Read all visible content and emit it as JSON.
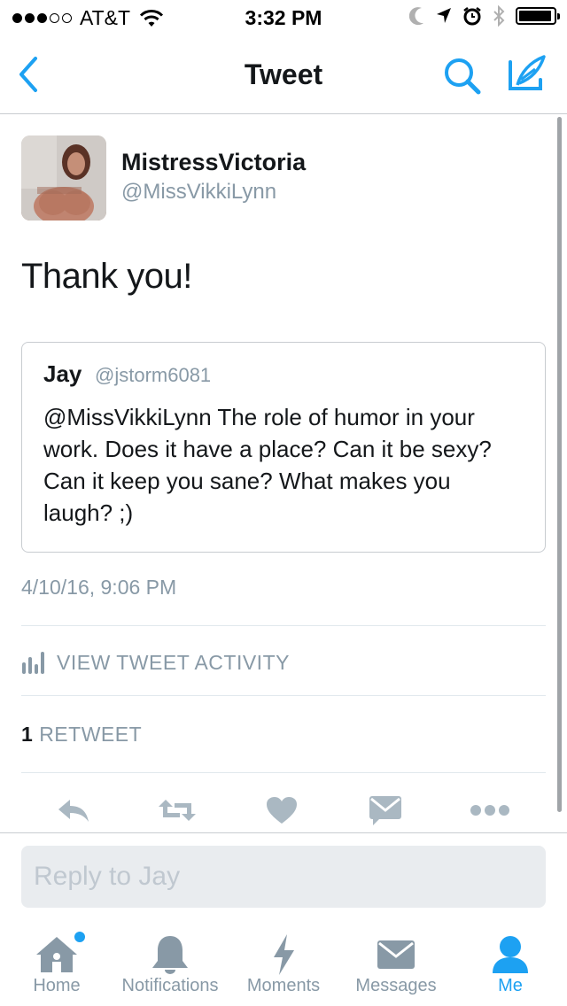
{
  "status_bar": {
    "carrier": "AT&T",
    "time": "3:32 PM",
    "signal_dots_filled": 3,
    "signal_dots_total": 5,
    "icons": [
      "wifi-icon",
      "moon-icon",
      "location-arrow-icon",
      "alarm-icon",
      "bluetooth-icon",
      "battery-icon"
    ]
  },
  "nav": {
    "title": "Tweet",
    "back_icon": "chevron-left-icon",
    "search_icon": "search-icon",
    "compose_icon": "compose-feather-icon"
  },
  "tweet": {
    "display_name": "MistressVictoria",
    "screen_name": "@MissVikkiLynn",
    "text": "Thank you!",
    "timestamp": "4/10/16, 9:06 PM",
    "activity_label": "VIEW TWEET ACTIVITY",
    "retweet_count": "1",
    "retweet_label": "RETWEET"
  },
  "quoted": {
    "name": "Jay",
    "handle": "@jstorm6081",
    "text": "@MissVikkiLynn The role of humor in your work. Does it have a place? Can it be sexy? Can it keep you sane? What makes you laugh? ;)"
  },
  "actions": [
    "reply-icon",
    "retweet-icon",
    "heart-icon",
    "direct-message-icon",
    "more-icon"
  ],
  "reply": {
    "placeholder": "Reply to Jay"
  },
  "tabs": [
    {
      "label": "Home",
      "icon": "home-icon",
      "badge": true
    },
    {
      "label": "Notifications",
      "icon": "bell-icon"
    },
    {
      "label": "Moments",
      "icon": "lightning-icon"
    },
    {
      "label": "Messages",
      "icon": "envelope-icon"
    },
    {
      "label": "Me",
      "icon": "person-icon",
      "active": true
    }
  ],
  "colors": {
    "accent": "#1da1f2",
    "text": "#14171a",
    "secondary": "#8899a6",
    "action_icon": "#aab8c2"
  }
}
